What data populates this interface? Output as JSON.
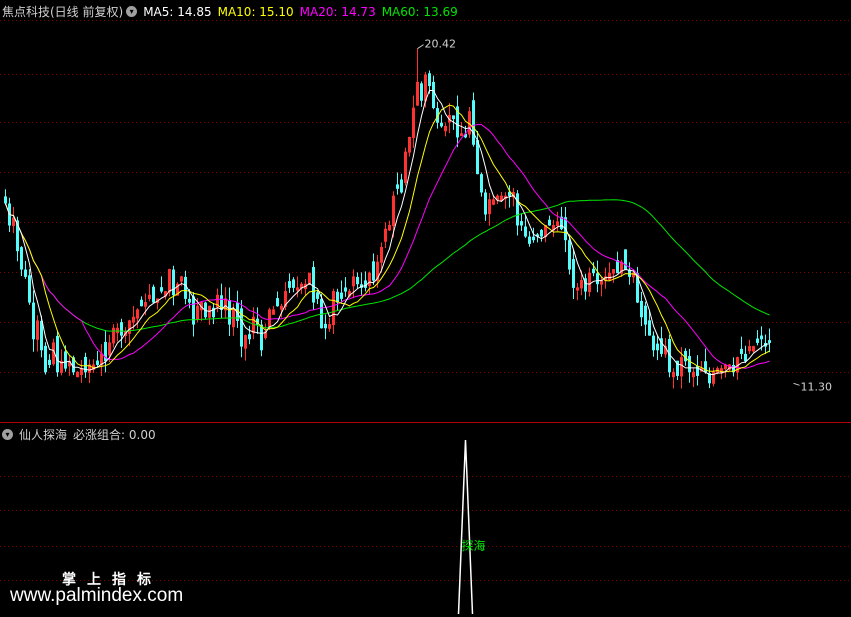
{
  "header": {
    "title": "焦点科技(日线 前复权)",
    "ma5": "MA5: 14.85",
    "ma10": "MA10: 15.10",
    "ma20": "MA20: 14.73",
    "ma60": "MA60: 13.69"
  },
  "indicator": {
    "title": "仙人探海",
    "value": "必涨组合: 0.00",
    "signal_label": "探海"
  },
  "watermark": {
    "cn": "掌上指标",
    "url": "www.palmindex.com"
  },
  "colors": {
    "up": "#ff3232",
    "down": "#54fcfc",
    "ma5": "#ffffff",
    "ma10": "#ffff00",
    "ma20": "#ff00ff",
    "ma60": "#00e600",
    "grid": "#800000",
    "signal": "#00e600"
  },
  "chart_data": {
    "type": "candlestick",
    "y_range": [
      10.3,
      21.2
    ],
    "max_label": "20.42",
    "min_label": "11.30",
    "max_index": 103,
    "min_index": 197,
    "closes": [
      16.2,
      15.6,
      15.8,
      14.9,
      14.4,
      14.2,
      13.5,
      12.5,
      13.0,
      12.2,
      11.6,
      11.8,
      12.4,
      11.6,
      11.9,
      11.7,
      11.9,
      11.6,
      11.6,
      11.7,
      11.6,
      11.8,
      11.8,
      11.8,
      12.1,
      11.9,
      12.4,
      12.8,
      12.8,
      12.6,
      12.7,
      13.0,
      13.1,
      13.3,
      13.4,
      13.5,
      13.7,
      13.5,
      13.6,
      13.8,
      13.8,
      14.4,
      13.7,
      14.0,
      14.2,
      13.6,
      13.5,
      12.9,
      13.4,
      13.5,
      13.1,
      13.4,
      13.1,
      13.7,
      13.3,
      13.6,
      12.9,
      13.3,
      13.0,
      12.3,
      12.6,
      12.5,
      13.1,
      12.9,
      12.2,
      12.7,
      13.3,
      13.3,
      13.4,
      13.4,
      13.8,
      13.9,
      13.9,
      13.9,
      14.0,
      14.0,
      14.3,
      13.5,
      13.6,
      12.8,
      12.8,
      12.9,
      13.8,
      13.5,
      13.6,
      13.8,
      13.8,
      14.2,
      14.0,
      13.9,
      13.9,
      14.3,
      14.1,
      14.6,
      15.0,
      15.5,
      15.6,
      16.4,
      16.6,
      16.5,
      17.6,
      18.0,
      18.8,
      19.5,
      19.0,
      19.7,
      19.4,
      18.8,
      18.4,
      18.3,
      18.3,
      18.6,
      18.5,
      18.0,
      18.1,
      18.0,
      18.7,
      17.8,
      17.0,
      16.5,
      15.9,
      16.3,
      16.3,
      16.4,
      16.4,
      16.4,
      16.4,
      16.5,
      15.6,
      15.6,
      15.3,
      15.1,
      15.2,
      15.3,
      15.3,
      15.6,
      15.6,
      15.6,
      15.7,
      15.5,
      15.2,
      14.4,
      13.9,
      13.9,
      14.1,
      13.8,
      14.3,
      14.3,
      14.0,
      14.1,
      14.2,
      14.3,
      14.4,
      14.3,
      14.6,
      14.4,
      14.2,
      14.3,
      13.5,
      13.1,
      12.9,
      12.6,
      12.2,
      12.2,
      12.1,
      12.3,
      11.6,
      11.6,
      11.5,
      12.0,
      11.9,
      11.6,
      11.6,
      11.5,
      11.7,
      11.6,
      11.3,
      11.6,
      11.7,
      11.7,
      11.8,
      11.8,
      11.6,
      12.0,
      12.1,
      11.9,
      12.3,
      12.3,
      12.4,
      12.5,
      12.3,
      12.4
    ],
    "ma_last": {
      "ma5": 14.85,
      "ma10": 15.1,
      "ma20": 14.73,
      "ma60": 13.69
    },
    "signal": {
      "index": 115,
      "value": 1.0
    },
    "signal_range": [
      0,
      1.0
    ]
  }
}
